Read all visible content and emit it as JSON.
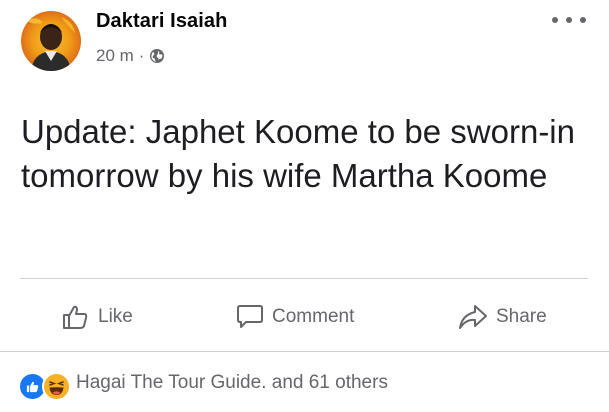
{
  "post": {
    "author": "Daktari Isaiah",
    "time": "20 m",
    "separator": "·",
    "privacy_icon": "globe-icon",
    "text": "Update: Japhet Koome to be sworn-in tomorrow by his wife Martha Koome"
  },
  "actions": {
    "like_label": "Like",
    "comment_label": "Comment",
    "share_label": "Share"
  },
  "reactions": {
    "summary": "Hagai The Tour Guide. and 61 others",
    "icons": [
      "like-reaction-icon",
      "haha-reaction-icon"
    ]
  },
  "colors": {
    "text": "#050505",
    "secondary": "#65676b",
    "divider": "#ced0d4",
    "like_blue": "#1877f2",
    "haha_yellow": "#f7b125"
  }
}
